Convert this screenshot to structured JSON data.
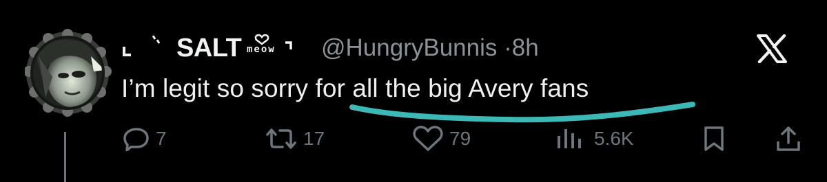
{
  "tweet": {
    "display_name": "SALT",
    "name_decoration": "meow",
    "handle": "@HungryBunnis",
    "separator": "·",
    "time": "8h",
    "text": "I’m legit so sorry for all the big Avery fans"
  },
  "actions": {
    "replies": "7",
    "retweets": "17",
    "likes": "79",
    "views": "5.6K"
  },
  "colors": {
    "background": "#000000",
    "text": "#e7e9ea",
    "muted": "#6e767d",
    "annotation_underline": "#3cb8b6"
  },
  "icons": [
    "reply-icon",
    "retweet-icon",
    "like-icon",
    "views-icon",
    "bookmark-icon",
    "share-icon",
    "x-logo-icon"
  ]
}
